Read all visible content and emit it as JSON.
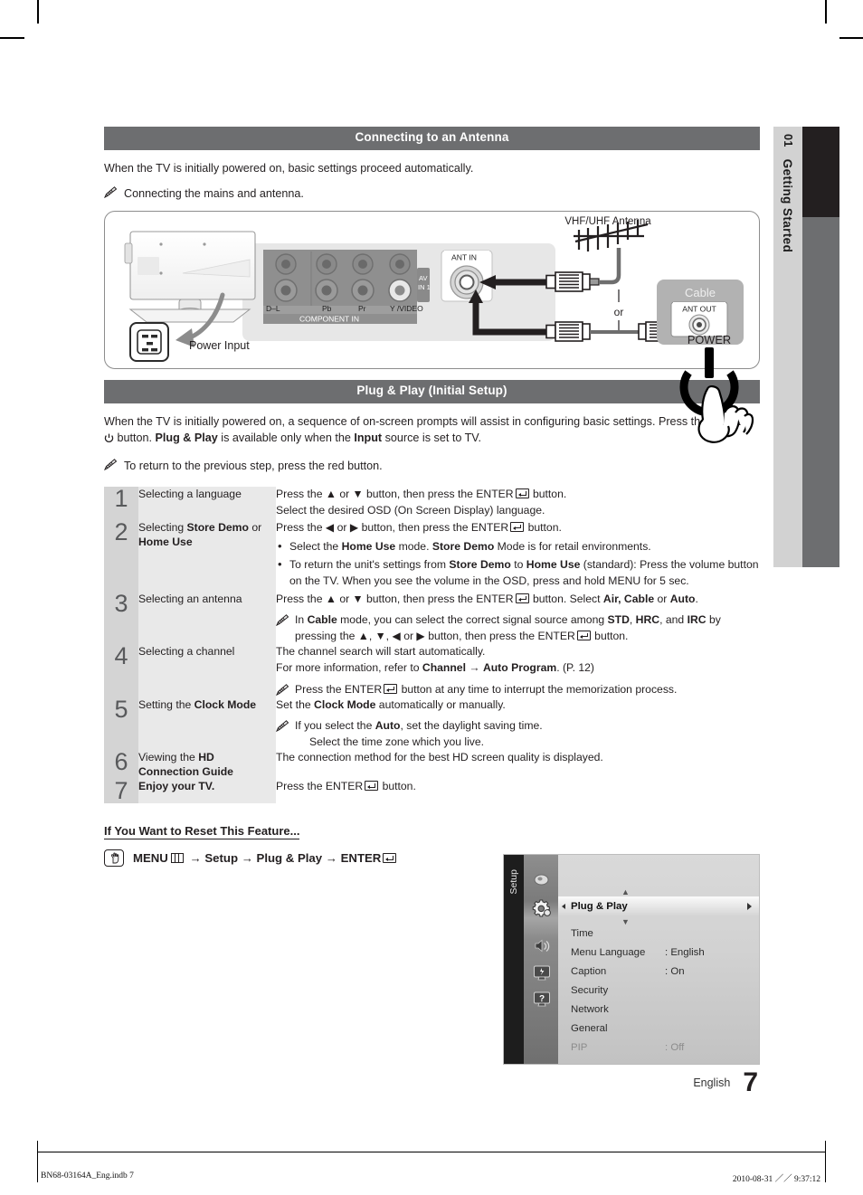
{
  "chapter_tab": {
    "number": "01",
    "label": "Getting Started"
  },
  "sections": [
    {
      "id": "antenna",
      "title": "Connecting to an Antenna",
      "intro": "When the TV is initially powered on, basic settings proceed automatically.",
      "note": "Connecting the mains and antenna.",
      "diagram": {
        "antenna_label": "VHF/UHF Antenna",
        "ant_in_label": "ANT IN",
        "av_in_label": "AV\nIN 1",
        "component_label": "COMPONENT IN",
        "jack_labels": [
          "ⓓ–ⓛ",
          "Pʙ",
          "Pʀ",
          "Y /VIDEO"
        ],
        "or_label": "or",
        "cable_label": "Cable",
        "ant_out_label": "ANT OUT",
        "power_input_label": "Power Input"
      }
    },
    {
      "id": "plug-and-play",
      "title": "Plug & Play (Initial Setup)",
      "intro_part1": "When the TV is initially powered on, a sequence of on-screen prompts will assist in configuring basic settings. Press the ",
      "intro_power": "POWER",
      "intro_part2": " button. ",
      "intro_pp": "Plug & Play",
      "intro_part3": " is available only when the ",
      "intro_input": "Input",
      "intro_part4": " source is set to TV.",
      "note": "To return to the previous step, press the red button.",
      "power_graphic_label": "POWER"
    }
  ],
  "steps": [
    {
      "number": "1",
      "title_plain": "Selecting a language",
      "lines": [
        "Press the ▲ or ▼ button, then press the ENTER ↵ button.",
        "Select the desired OSD (On Screen Display) language."
      ]
    },
    {
      "number": "2",
      "title_pre": "Selecting ",
      "title_b1": "Store Demo",
      "title_mid": " or ",
      "title_b2": "Home Use",
      "lines": [
        "Press the ◀ or ▶ button, then press the ENTER ↵ button."
      ],
      "bullets": [
        "Select the Home Use mode. Store Demo Mode is for retail environments.",
        "To return the unit's settings from Store Demo to Home Use (standard): Press the volume button on the TV. When you see the volume in the OSD, press and hold MENU for 5 sec."
      ]
    },
    {
      "number": "3",
      "title_plain": "Selecting an antenna",
      "lines": [
        "Press the ▲ or ▼ button, then press the ENTER ↵ button. Select Air, Cable or Auto."
      ],
      "note": "In Cable mode, you can select the correct signal source among STD, HRC, and IRC by pressing the ▲, ▼, ◀ or ▶ button, then press the ENTER ↵ button."
    },
    {
      "number": "4",
      "title_plain": "Selecting a channel",
      "lines": [
        "The channel search will start automatically.",
        "For more information, refer to Channel → Auto Program. (P. 12)"
      ],
      "note": "Press the ENTER ↵ button at any time to interrupt the memorization process."
    },
    {
      "number": "5",
      "title_pre": "Setting the ",
      "title_b1": "Clock Mode",
      "lines": [
        "Set the Clock Mode automatically or manually."
      ],
      "note": "If you select the Auto, set the daylight saving time.",
      "note_second_line": "Select the time zone which you live."
    },
    {
      "number": "6",
      "title_pre": "Viewing the ",
      "title_b1": "HD Connection Guide",
      "lines": [
        "The connection method for the best HD screen quality is displayed."
      ]
    },
    {
      "number": "7",
      "title_bold": "Enjoy your TV.",
      "lines": [
        "Press the ENTER ↵ button."
      ]
    }
  ],
  "reset": {
    "heading": "If You Want to Reset This Feature...",
    "path_menu": "MENU",
    "path_arrow": "→",
    "path_setup": "Setup",
    "path_plugplay": "Plug & Play",
    "path_enter": "ENTER"
  },
  "osd": {
    "tab_label": "Setup",
    "rows": [
      {
        "label": "Plug & Play",
        "value": "",
        "selected": true,
        "dim": false
      },
      {
        "label": "Time",
        "value": "",
        "selected": false,
        "dim": false
      },
      {
        "label": "Menu Language",
        "value": ": English",
        "selected": false,
        "dim": false
      },
      {
        "label": "Caption",
        "value": ": On",
        "selected": false,
        "dim": false
      },
      {
        "label": "Security",
        "value": "",
        "selected": false,
        "dim": false
      },
      {
        "label": "Network",
        "value": "",
        "selected": false,
        "dim": false
      },
      {
        "label": "General",
        "value": "",
        "selected": false,
        "dim": false
      },
      {
        "label": "PIP",
        "value": ": Off",
        "selected": false,
        "dim": true
      }
    ],
    "sidebar_icons": [
      "picture-icon",
      "setup-gear-icon",
      "sound-icon",
      "input-icon",
      "support-icon"
    ]
  },
  "page_footer": {
    "language": "English",
    "page_number": "7"
  },
  "print_footer": {
    "left": "BN68-03164A_Eng.indb   7",
    "right": "2010-08-31   ／／ 9:37:12"
  },
  "colors": {
    "bar": "#6d6e70",
    "tab_dark": "#231f20",
    "tab_light": "#d2d2d2",
    "num_cell": "#d4d4d4",
    "title_cell": "#e9e9e9"
  }
}
